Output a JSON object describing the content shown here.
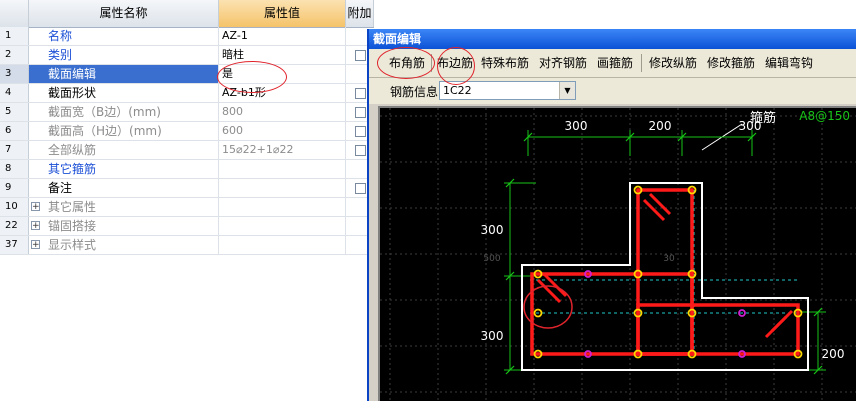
{
  "grid": {
    "headers": {
      "name": "属性名称",
      "value": "属性值",
      "extra": "附加"
    },
    "rows": [
      {
        "num": "1",
        "name": "名称",
        "value": "AZ-1",
        "nameColor": "blue",
        "check": false
      },
      {
        "num": "2",
        "name": "类别",
        "value": "暗柱",
        "nameColor": "blue",
        "check": true
      },
      {
        "num": "3",
        "name": "截面编辑",
        "value": "是",
        "nameColor": "sel",
        "check": false
      },
      {
        "num": "4",
        "name": "截面形状",
        "value": "AZ-b1形",
        "nameColor": "black",
        "check": true
      },
      {
        "num": "5",
        "name": "截面宽（B边）(mm)",
        "value": "800",
        "nameColor": "gray",
        "check": true
      },
      {
        "num": "6",
        "name": "截面高（H边）(mm)",
        "value": "600",
        "nameColor": "gray",
        "check": true
      },
      {
        "num": "7",
        "name": "全部纵筋",
        "value": "15⌀22+1⌀22",
        "nameColor": "gray",
        "check": true
      },
      {
        "num": "8",
        "name": "其它箍筋",
        "value": "",
        "nameColor": "blue",
        "check": false
      },
      {
        "num": "9",
        "name": "备注",
        "value": "",
        "nameColor": "black",
        "check": true
      },
      {
        "num": "10",
        "name": "其它属性",
        "value": "",
        "nameColor": "gray",
        "check": false,
        "expand": true
      },
      {
        "num": "22",
        "name": "锚固搭接",
        "value": "",
        "nameColor": "gray",
        "check": false,
        "expand": true
      },
      {
        "num": "37",
        "name": "显示样式",
        "value": "",
        "nameColor": "gray",
        "check": false,
        "expand": true
      }
    ]
  },
  "window": {
    "title": "截面编辑",
    "toolbar": [
      "布角筋",
      "布边筋",
      "特殊布筋",
      "对齐钢筋",
      "画箍筋",
      "修改纵筋",
      "修改箍筋",
      "编辑弯钩"
    ],
    "info_label": "钢筋信息",
    "info_value": "1C22"
  },
  "canvas": {
    "dims": {
      "top_left": "300",
      "top_mid": "200",
      "top_right": "300",
      "left_top": "300",
      "left_bottom": "300",
      "right": "200",
      "ghost_left": "500",
      "ghost_mid": "30"
    },
    "labels": {
      "stirrup": "箍筋",
      "spec": "A8@150"
    },
    "colors": {
      "dimension": "#18c418",
      "outline": "#ffffff",
      "stirrup": "#ff1a1a",
      "bar": "#ffd700",
      "magenta": "#d020d0",
      "grid": "#3c3c3c",
      "dash": "#22c7c7",
      "annotation": "#e0242c",
      "spec": "#18c418"
    }
  }
}
